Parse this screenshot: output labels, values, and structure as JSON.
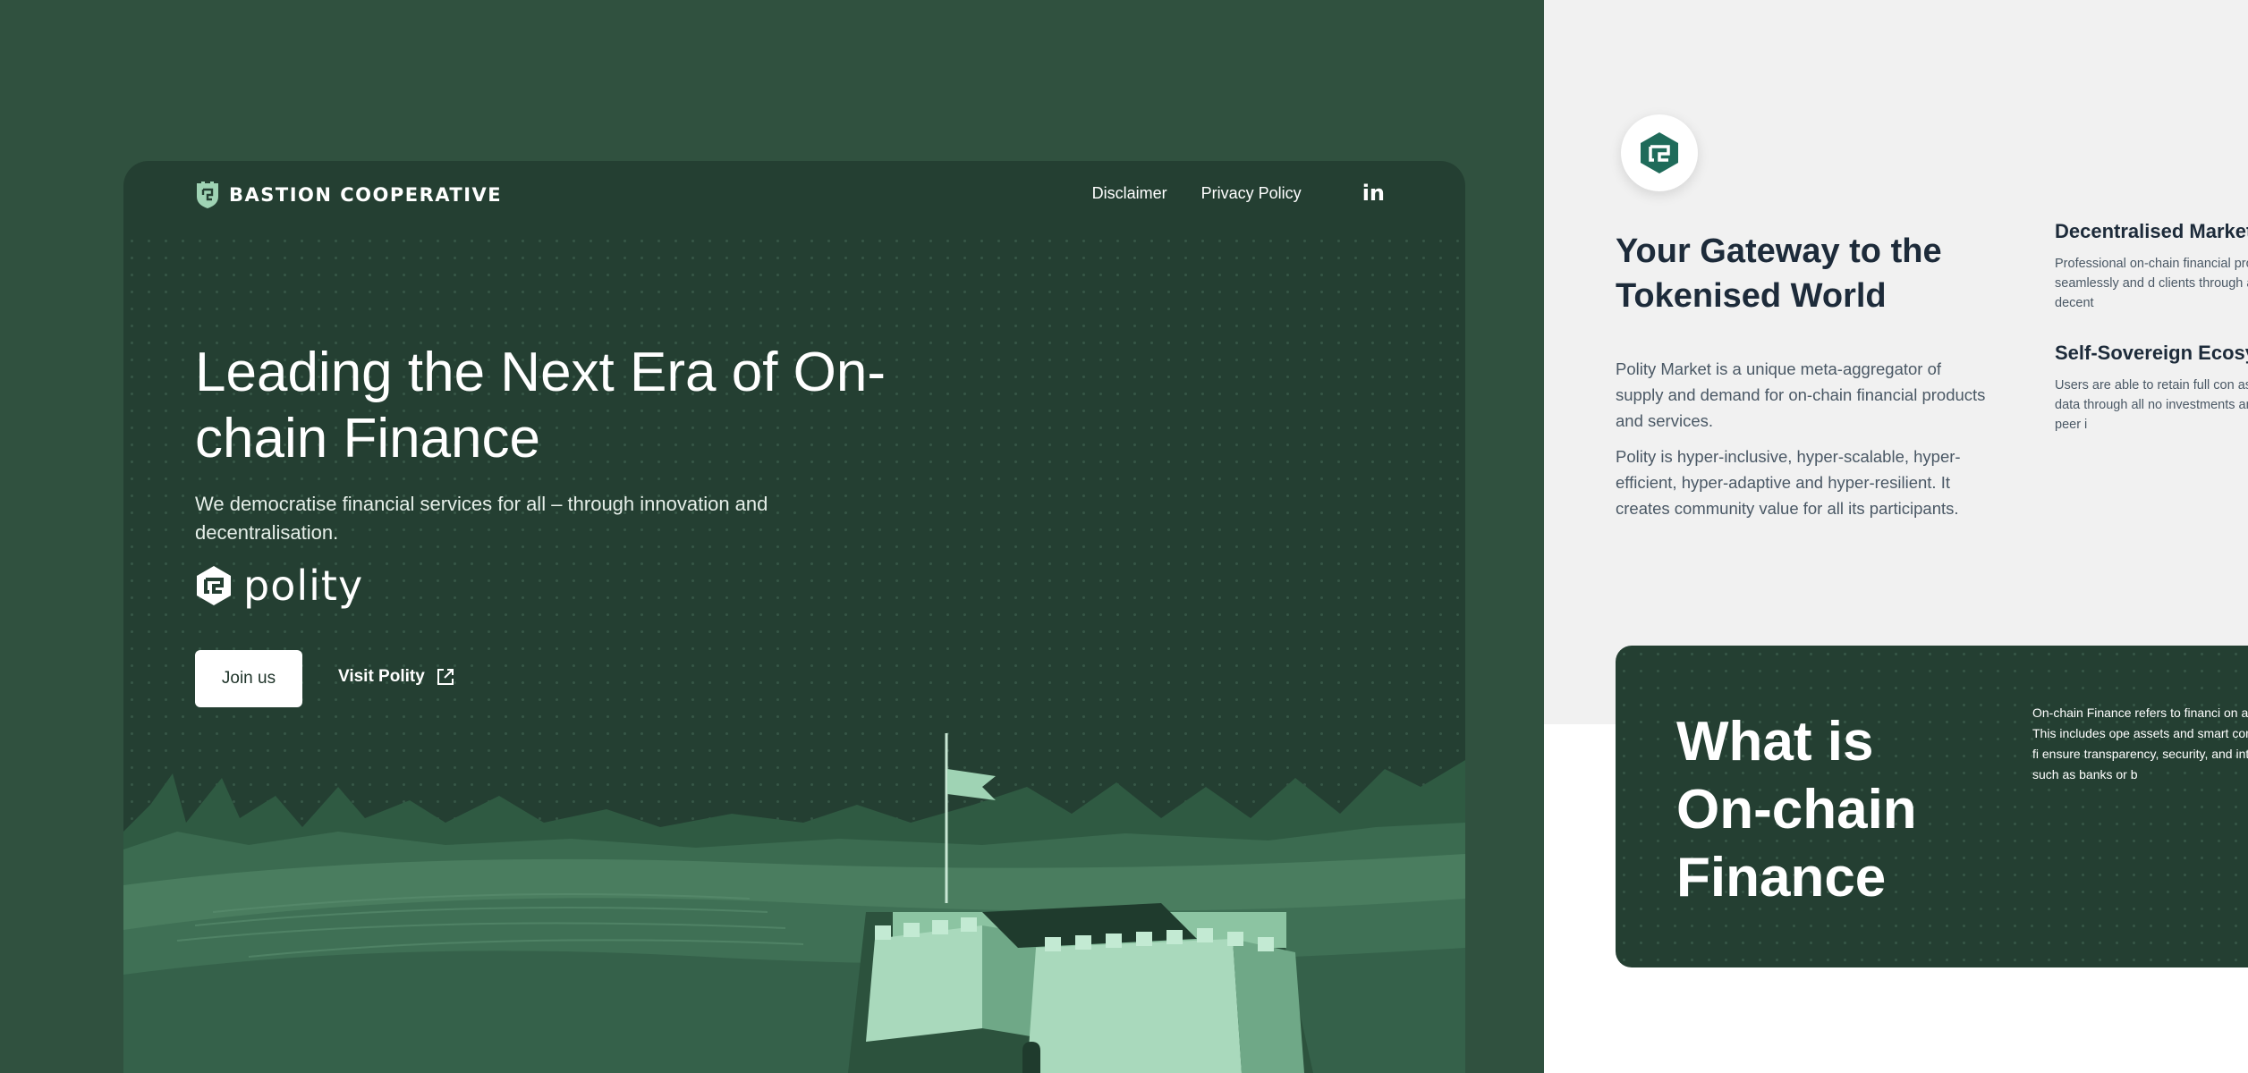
{
  "brand": {
    "name": "BASTION COOPERATIVE"
  },
  "nav": {
    "items": [
      "Disclaimer",
      "Privacy Policy"
    ],
    "social_icon": "linkedin-icon",
    "social_label": "in"
  },
  "hero": {
    "title": "Leading the Next Era of On-chain Finance",
    "subtitle": "We democratise financial services for all – through innovation and decentralisation.",
    "partner_logo": "polity",
    "join_label": "Join us",
    "visit_label": "Visit Polity",
    "visit_icon": "external-link-icon"
  },
  "gateway": {
    "title": "Your Gateway to the Tokenised World",
    "p1": "Polity Market is a unique meta-aggregator of supply and demand for on-chain financial products and services.",
    "p2": "Polity is hyper-inclusive, hyper-scalable, hyper-efficient, hyper-adaptive and hyper-resilient. It creates community value for all its participants."
  },
  "features": [
    {
      "title": "Decentralised Market",
      "body": "Professional on-chain financial providers are seamlessly and d clients through a secure decent"
    },
    {
      "title": "Self-Sovereign Ecosy",
      "body": "Users are able to retain full con assets, and data through all no investments and peer-to-peer i"
    }
  ],
  "what_is": {
    "title": "What is On-chain Finance",
    "body": "On-chain Finance refers to financi on a blockchain. This includes ope assets and smart contract-based fi ensure transparency, security, and intermediaries, such as banks or b"
  },
  "colors": {
    "dark_green": "#243f32",
    "mid_green": "#30513f",
    "light_green": "#9fd3b4",
    "text_dark": "#1d2b3a"
  }
}
